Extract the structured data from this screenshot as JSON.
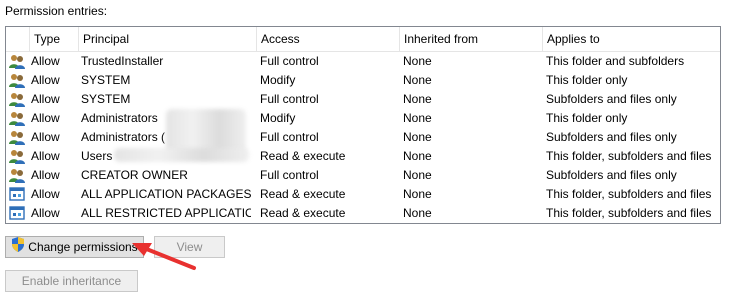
{
  "section_label": "Permission entries:",
  "columns": {
    "type": "Type",
    "principal": "Principal",
    "access": "Access",
    "inherited_from": "Inherited from",
    "applies_to": "Applies to"
  },
  "entries": [
    {
      "icon": "user-group-icon",
      "type": "Allow",
      "principal": "TrustedInstaller",
      "access": "Full control",
      "inherited_from": "None",
      "applies_to": "This folder and subfolders"
    },
    {
      "icon": "user-group-icon",
      "type": "Allow",
      "principal": "SYSTEM",
      "access": "Modify",
      "inherited_from": "None",
      "applies_to": "This folder only"
    },
    {
      "icon": "user-group-icon",
      "type": "Allow",
      "principal": "SYSTEM",
      "access": "Full control",
      "inherited_from": "None",
      "applies_to": "Subfolders and files only"
    },
    {
      "icon": "user-group-icon",
      "type": "Allow",
      "principal": "Administrators",
      "access": "Modify",
      "inherited_from": "None",
      "applies_to": "This folder only"
    },
    {
      "icon": "user-group-icon",
      "type": "Allow",
      "principal": "Administrators (",
      "access": "Full control",
      "inherited_from": "None",
      "applies_to": "Subfolders and files only"
    },
    {
      "icon": "user-group-icon",
      "type": "Allow",
      "principal": "Users",
      "access": "Read & execute",
      "inherited_from": "None",
      "applies_to": "This folder, subfolders and files"
    },
    {
      "icon": "user-group-icon",
      "type": "Allow",
      "principal": "CREATOR OWNER",
      "access": "Full control",
      "inherited_from": "None",
      "applies_to": "Subfolders and files only"
    },
    {
      "icon": "app-package-icon",
      "type": "Allow",
      "principal": "ALL APPLICATION PACKAGES",
      "access": "Read & execute",
      "inherited_from": "None",
      "applies_to": "This folder, subfolders and files"
    },
    {
      "icon": "app-package-icon",
      "type": "Allow",
      "principal": "ALL RESTRICTED APPLICATIO...",
      "access": "Read & execute",
      "inherited_from": "None",
      "applies_to": "This folder, subfolders and files"
    }
  ],
  "buttons": {
    "change_permissions": "Change permissions",
    "view": "View",
    "enable_inheritance": "Enable inheritance"
  },
  "colors": {
    "annotation_arrow": "#e8312f",
    "shield_blue": "#2a6fd1",
    "shield_yellow": "#f2c230"
  }
}
